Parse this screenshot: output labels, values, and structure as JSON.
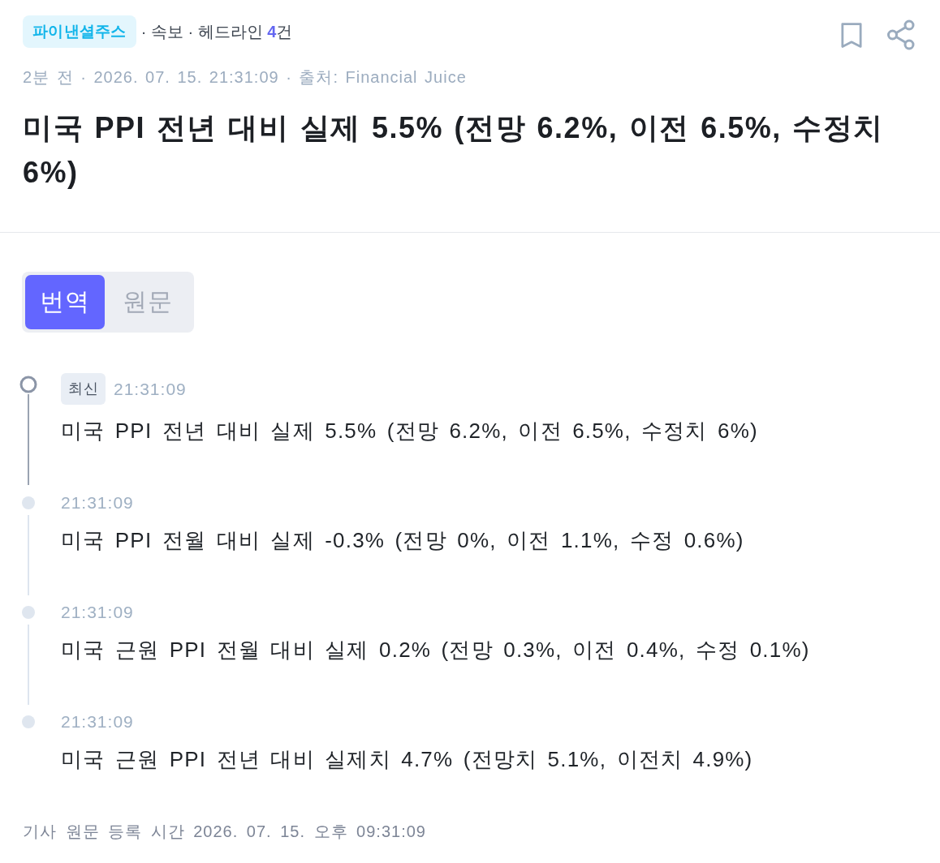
{
  "header": {
    "source_badge": "파이낸셜주스",
    "category_line": "· 속보 · 헤드라인 **4**건",
    "meta": "2분 전 · 2026. 07. 15. 21:31:09 · 출처: Financial Juice"
  },
  "title": "미국 PPI 전년 대비 실제 5.5% (전망 6.2%, 이전 6.5%, 수정치 6%)",
  "tabs": [
    {
      "label": "번역",
      "selected": true
    },
    {
      "label": "원문",
      "selected": false
    }
  ],
  "timeline": [
    {
      "badge": "최신",
      "time": "21:31:09",
      "text": "미국 PPI 전년 대비 실제 5.5% (전망 6.2%, 이전 6.5%, 수정치 6%)",
      "current": true
    },
    {
      "time": "21:31:09",
      "text": "미국 PPI 전월 대비 실제 -0.3% (전망 0%, 이전 1.1%, 수정 0.6%)",
      "current": false
    },
    {
      "time": "21:31:09",
      "text": "미국 근원 PPI 전월 대비 실제 0.2% (전망 0.3%, 이전 0.4%, 수정 0.1%)",
      "current": false
    },
    {
      "time": "21:31:09",
      "text": "미국 근원 PPI 전년 대비 실제치 4.7% (전망치 5.1%, 이전치 4.9%)",
      "current": false
    }
  ],
  "footer": "기사 원문 등록 시간 2026. 07. 15. 오후 09:31:09"
}
